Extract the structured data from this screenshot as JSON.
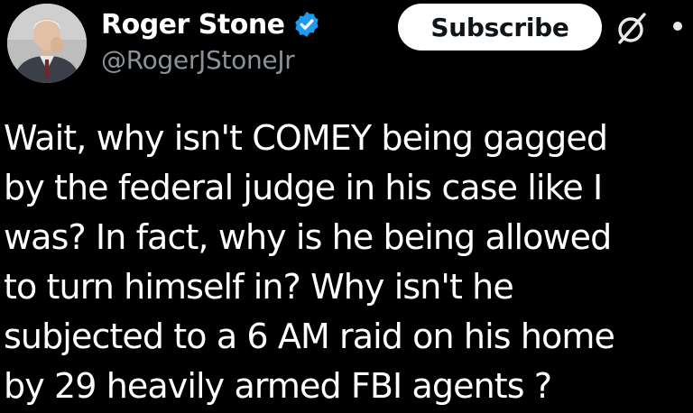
{
  "author": {
    "display_name": "Roger Stone",
    "handle": "@RogerJStoneJr",
    "verified": true
  },
  "actions": {
    "subscribe_label": "Subscribe",
    "grok_icon": "grok-slash-circle-icon",
    "more_icon": "more-dots-icon"
  },
  "tweet": {
    "lines": [
      "Wait, why isn't COMEY being gagged",
      "by the federal judge in his case  like I",
      "was?  In fact, why is he being allowed",
      "to turn himself in? Why isn't he",
      "subjected to a 6 AM raid on his home",
      "by 29 heavily armed FBI agents ?"
    ]
  },
  "colors": {
    "background": "#000000",
    "text": "#ffffff",
    "handle": "#8b9299",
    "verified_badge": "#1d9bf0",
    "button_bg": "#ffffff",
    "button_text": "#0f1419"
  }
}
